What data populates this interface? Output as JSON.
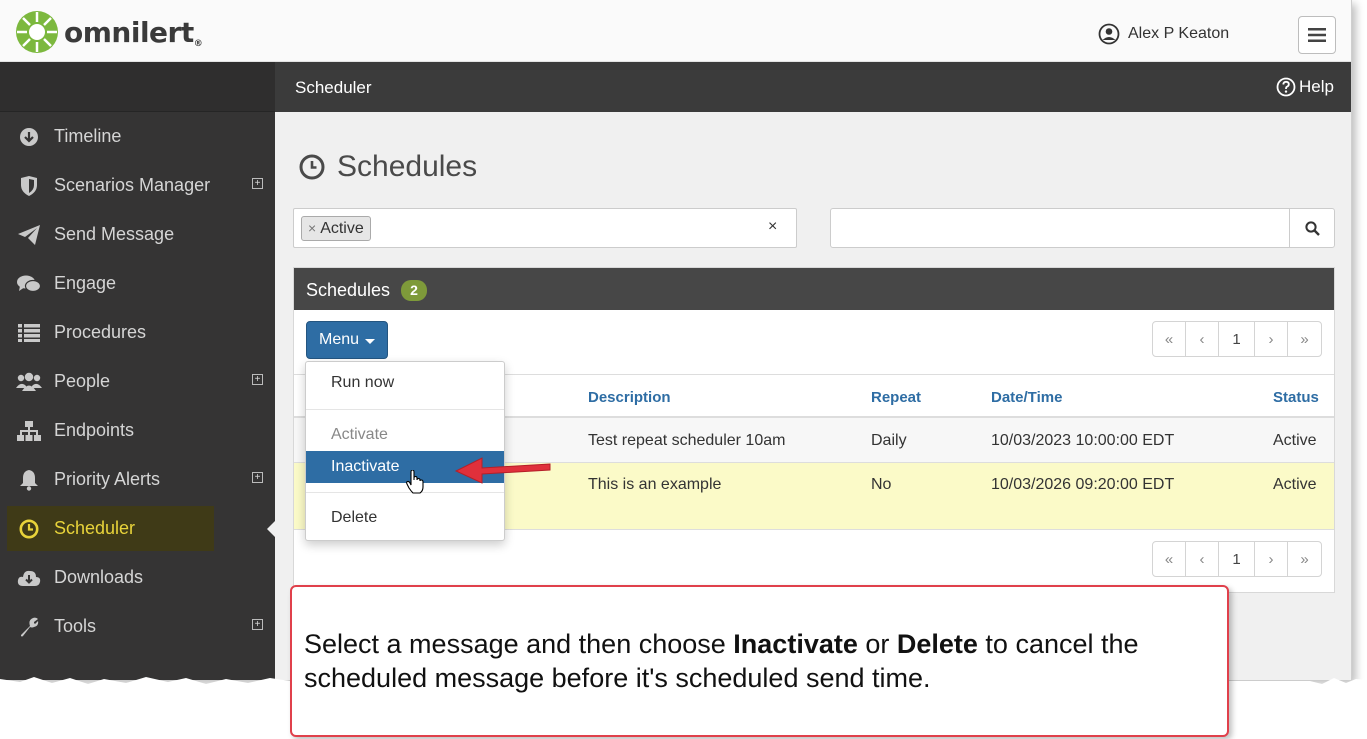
{
  "brand": {
    "name": "omnilert",
    "reg": "®"
  },
  "header": {
    "user_name": "Alex P Keaton"
  },
  "sidebar": {
    "items": [
      {
        "label": "Timeline",
        "icon": "arrow-down-circle-icon",
        "expandable": false
      },
      {
        "label": "Scenarios Manager",
        "icon": "shield-icon",
        "expandable": true
      },
      {
        "label": "Send Message",
        "icon": "paper-plane-icon",
        "expandable": false
      },
      {
        "label": "Engage",
        "icon": "chat-bubbles-icon",
        "expandable": false
      },
      {
        "label": "Procedures",
        "icon": "list-icon",
        "expandable": false
      },
      {
        "label": "People",
        "icon": "users-icon",
        "expandable": true
      },
      {
        "label": "Endpoints",
        "icon": "sitemap-icon",
        "expandable": false
      },
      {
        "label": "Priority Alerts",
        "icon": "bell-icon",
        "expandable": true
      },
      {
        "label": "Scheduler",
        "icon": "clock-icon",
        "expandable": false,
        "active": true
      },
      {
        "label": "Downloads",
        "icon": "cloud-download-icon",
        "expandable": false
      },
      {
        "label": "Tools",
        "icon": "wrench-icon",
        "expandable": true
      }
    ]
  },
  "main": {
    "breadcrumb": "Scheduler",
    "help_label": "Help",
    "page_title": "Schedules",
    "filter": {
      "chip_label": "Active",
      "chip_remove": "×",
      "clear": "×"
    },
    "search": {
      "value": "",
      "placeholder": ""
    },
    "panel": {
      "title": "Schedules",
      "count": "2",
      "menu_label": "Menu",
      "pager": {
        "first": "«",
        "prev": "‹",
        "page": "1",
        "next": "›",
        "last": "»"
      },
      "columns": {
        "description": "Description",
        "repeat": "Repeat",
        "datetime": "Date/Time",
        "status": "Status"
      },
      "rows": [
        {
          "description": "Test repeat scheduler 10am",
          "repeat": "Daily",
          "datetime": "10/03/2023 10:00:00 EDT",
          "status": "Active",
          "selected": false
        },
        {
          "description": "This is an example",
          "repeat": "No",
          "datetime": "10/03/2026 09:20:00 EDT",
          "status": "Active",
          "selected": true
        }
      ]
    },
    "menu_dropdown": {
      "items": [
        {
          "label": "Run now",
          "state": "enabled"
        },
        {
          "label": "Activate",
          "state": "disabled"
        },
        {
          "label": "Inactivate",
          "state": "hover"
        },
        {
          "label": "Delete",
          "state": "enabled"
        }
      ]
    }
  },
  "annotation": {
    "text_1": "Select a message and then choose ",
    "bold_1": "Inactivate",
    "text_2": " or ",
    "bold_2": "Delete",
    "text_3": " to cancel the scheduled message before it's scheduled send time."
  },
  "colors": {
    "sidebar_bg": "#353434",
    "active_accent": "#e8d33a",
    "primary_blue": "#2e6da4",
    "badge_green": "#7e9a3a",
    "selected_row": "#fbfac8",
    "callout_border": "#e0404b",
    "arrow_red": "#e0303b"
  }
}
